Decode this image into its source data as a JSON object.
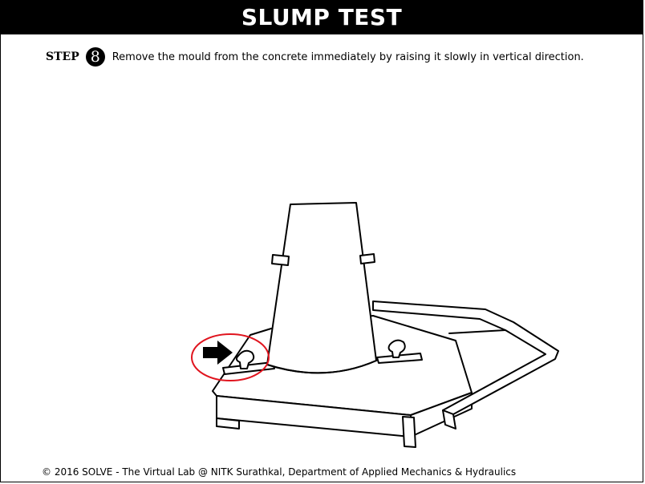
{
  "header": {
    "title": "SLUMP TEST"
  },
  "step": {
    "label": "STEP",
    "number": "8",
    "instruction": "Remove the mould from the concrete immediately by raising it slowly in vertical direction."
  },
  "illustration": {
    "highlight_color": "#e0141e",
    "arrow_icon": "arrow-right-icon"
  },
  "footer": {
    "copyright": "© 2016 SOLVE - The Virtual Lab @ NITK Surathkal, Department of Applied Mechanics & Hydraulics"
  }
}
